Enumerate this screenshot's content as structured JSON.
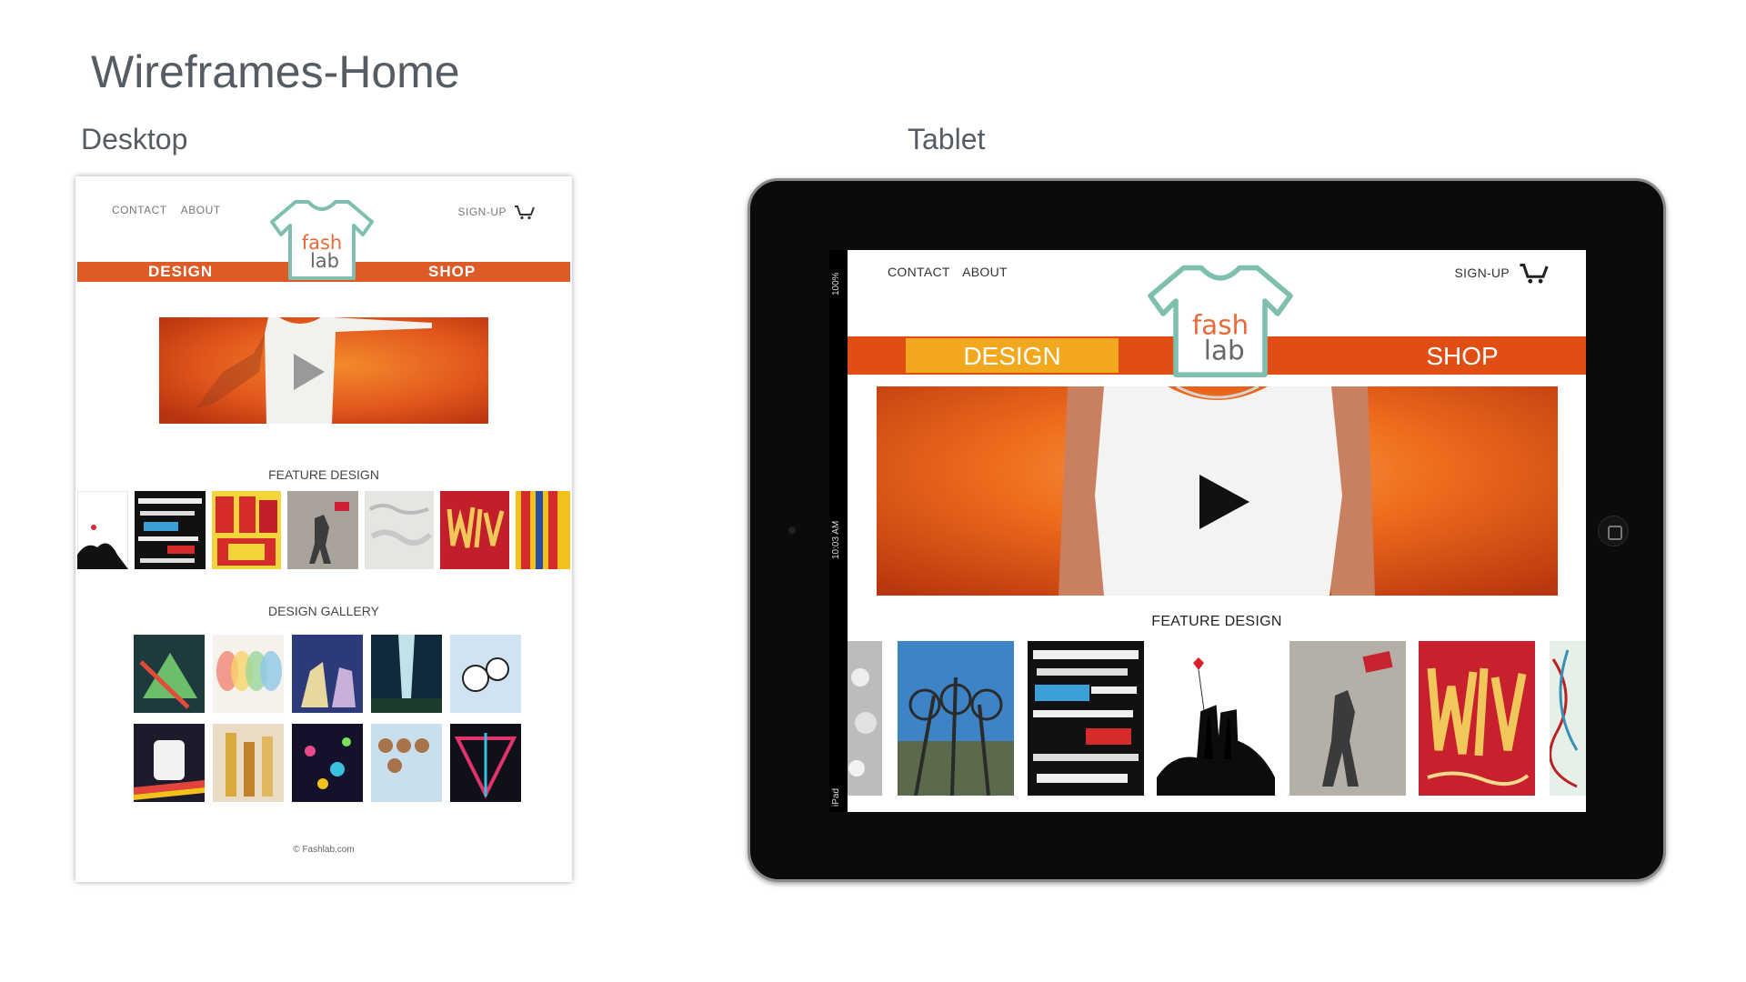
{
  "slide": {
    "title": "Wireframes-Home",
    "desktop_label": "Desktop",
    "tablet_label": "Tablet"
  },
  "brand": {
    "logo_line1": "fash",
    "logo_line2": "lab",
    "orange": "#de5a26",
    "yellow": "#f2a81e",
    "teal": "#7fbfb0"
  },
  "desktop": {
    "nav_contact": "CONTACT",
    "nav_about": "ABOUT",
    "nav_signup": "SIGN-UP",
    "design_label": "DESIGN",
    "shop_label": "SHOP",
    "feature_heading": "FEATURE DESIGN",
    "gallery_heading": "DESIGN GALLERY",
    "footer": "© Fashlab.com"
  },
  "tablet": {
    "status_battery": "100%",
    "status_time": "10:03 AM",
    "status_carrier": "iPad",
    "nav_contact": "CONTACT",
    "nav_about": "ABOUT",
    "nav_signup": "SIGN-UP",
    "design_label": "DESIGN",
    "shop_label": "SHOP",
    "feature_heading": "FEATURE DESIGN"
  }
}
